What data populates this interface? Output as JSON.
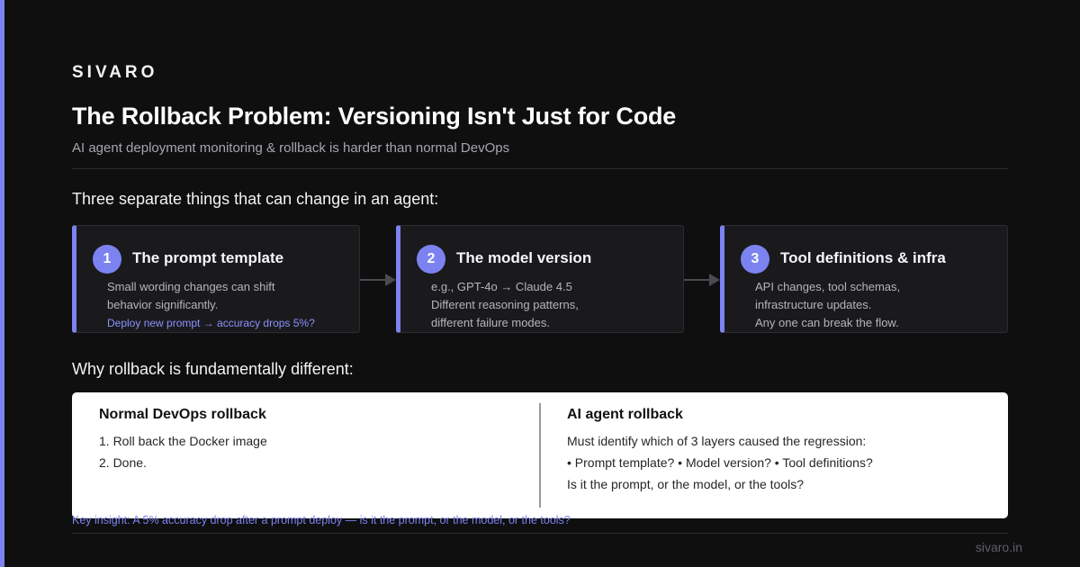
{
  "brand": "SIVARO",
  "title": "The Rollback Problem: Versioning Isn't Just for Code",
  "subtitle": "AI agent deployment monitoring & rollback is harder than normal DevOps",
  "section1": "Three separate things that can change in an agent:",
  "cards": [
    {
      "number": "1",
      "title": "The prompt template",
      "line1": "Small wording changes can shift",
      "line2": "behavior significantly.",
      "link": "Deploy new prompt → accuracy drops 5%?"
    },
    {
      "number": "2",
      "title": "The model version",
      "line1": "e.g., GPT-4o → Claude 4.5",
      "line2": "Different reasoning patterns,",
      "line3": "different failure modes."
    },
    {
      "number": "3",
      "title": "Tool definitions & infra",
      "line1": "API changes, tool schemas,",
      "line2": "infrastructure updates.",
      "line3": "Any one can break the flow."
    }
  ],
  "section2": "Why rollback is fundamentally different:",
  "comparison": {
    "left": {
      "title": "Normal DevOps rollback",
      "lines": [
        "1. Roll back the Docker image",
        "2. Done."
      ]
    },
    "right": {
      "title": "AI agent rollback",
      "lines": [
        "Must identify which of 3 layers caused the regression:",
        "• Prompt template? • Model version? • Tool definitions?",
        "Is it the prompt, or the model, or the tools?"
      ]
    }
  },
  "insight": "Key insight: A 5% accuracy drop after a prompt deploy — is it the prompt, or the model, or the tools?",
  "footer": "sivaro.in",
  "colors": {
    "accent": "#7c83f0",
    "background": "#0f0f10",
    "card": "#1a1a1d",
    "panel": "#ffffff"
  }
}
